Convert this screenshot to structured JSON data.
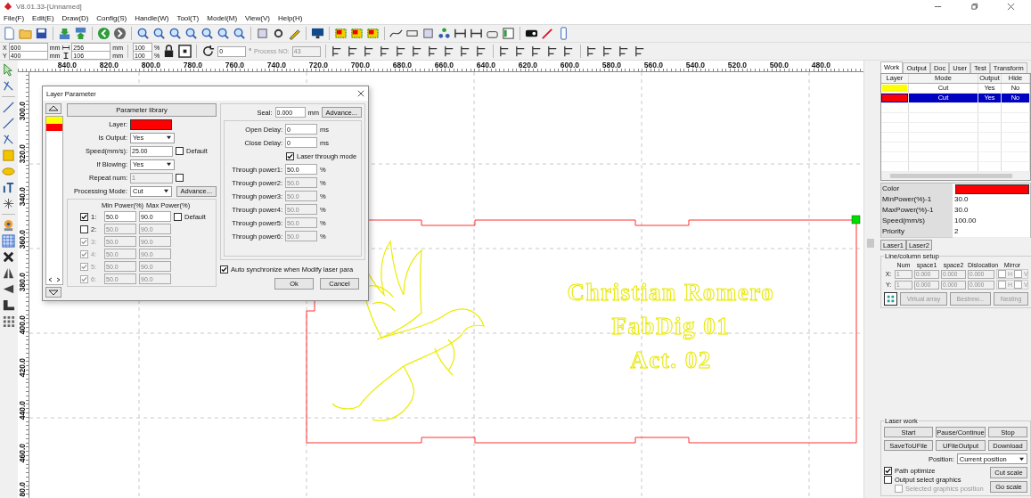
{
  "window": {
    "title": "V8.01.33-[Unnamed]"
  },
  "menu": [
    "File(F)",
    "Edit(E)",
    "Draw(D)",
    "Config(S)",
    "Handle(W)",
    "Tool(T)",
    "Model(M)",
    "View(V)",
    "Help(H)"
  ],
  "size_bar": {
    "x": {
      "label": "X",
      "value": "600",
      "unit": "mm"
    },
    "y": {
      "label": "Y",
      "value": "400",
      "unit": "mm"
    },
    "width": {
      "value": "256",
      "unit": "mm"
    },
    "height": {
      "value": "106",
      "unit": "mm"
    },
    "scale_x": {
      "value": "100",
      "unit": "%"
    },
    "scale_y": {
      "value": "100",
      "unit": "%"
    },
    "rotation": {
      "value": "0",
      "unit": "°"
    },
    "process": {
      "label": "Process NO:",
      "value": "43"
    }
  },
  "ruler": {
    "horizontal": [
      "840.0",
      "820.0",
      "800.0",
      "780.0",
      "760.0",
      "740.0",
      "720.0",
      "700.0",
      "680.0",
      "660.0",
      "640.0",
      "620.0",
      "600.0",
      "580.0",
      "560.0",
      "540.0",
      "520.0",
      "500.0",
      "480.0"
    ],
    "vertical": [
      "300.0",
      "320.0",
      "340.0",
      "360.0",
      "380.0",
      "400.0",
      "420.0",
      "440.0",
      "460.0",
      "80.0"
    ]
  },
  "canvas": {
    "texts": [
      "Christian Romero",
      "FabDig 01",
      "Act. 02"
    ]
  },
  "dialog": {
    "title": "Layer Parameter",
    "layers": [
      {
        "color": "#ffff00"
      },
      {
        "color": "#ff0000"
      }
    ],
    "library_button": "Parameter library",
    "layer": {
      "label": "Layer:",
      "color": "#ff0000"
    },
    "fields": [
      {
        "kind": "select",
        "label": "Is Output:",
        "value": "Yes"
      },
      {
        "kind": "input",
        "label": "Speed(mm/s):",
        "value": "25.00",
        "disabled": false,
        "check": {
          "label": "Default",
          "checked": false
        }
      },
      {
        "kind": "select",
        "label": "If Blowing:",
        "value": "Yes"
      },
      {
        "kind": "input",
        "label": "Repeat num:",
        "value": "1",
        "disabled": true,
        "check": {
          "checked": false
        }
      },
      {
        "kind": "select",
        "label": "Processing Mode:",
        "value": "Cut",
        "button": "Advance..."
      }
    ],
    "power_headers": [
      "Min Power(%)",
      "Max Power(%)"
    ],
    "power_default": {
      "label": "Default",
      "checked": false
    },
    "power_rows": [
      {
        "label": "1:",
        "checked": true,
        "disabled": false,
        "min": "50.0",
        "max": "90.0"
      },
      {
        "label": "2:",
        "checked": false,
        "disabled": false,
        "min": "50.0",
        "max": "90.0"
      },
      {
        "label": "3:",
        "checked": true,
        "disabled": true,
        "min": "50.0",
        "max": "90.0"
      },
      {
        "label": "4:",
        "checked": true,
        "disabled": true,
        "min": "50.0",
        "max": "90.0"
      },
      {
        "label": "5:",
        "checked": true,
        "disabled": true,
        "min": "50.0",
        "max": "90.0"
      },
      {
        "label": "6:",
        "checked": true,
        "disabled": true,
        "min": "50.0",
        "max": "90.0"
      }
    ],
    "seal": {
      "label": "Seal:",
      "value": "0.000",
      "unit": "mm",
      "button": "Advance..."
    },
    "delays": [
      {
        "label": "Open Delay:",
        "value": "0",
        "unit": "ms"
      },
      {
        "label": "Close Delay:",
        "value": "0",
        "unit": "ms"
      }
    ],
    "through_mode": {
      "label": "Laser through mode",
      "checked": true
    },
    "through_powers": [
      {
        "label": "Through power1:",
        "value": "50.0",
        "unit": "%",
        "disabled": false
      },
      {
        "label": "Through power2:",
        "value": "50.0",
        "unit": "%",
        "disabled": true
      },
      {
        "label": "Through power3:",
        "value": "50.0",
        "unit": "%",
        "disabled": true
      },
      {
        "label": "Through power4:",
        "value": "50.0",
        "unit": "%",
        "disabled": true
      },
      {
        "label": "Through power5:",
        "value": "50.0",
        "unit": "%",
        "disabled": true
      },
      {
        "label": "Through power6:",
        "value": "50.0",
        "unit": "%",
        "disabled": true
      }
    ],
    "auto_sync": {
      "label": "Auto synchronize when Modify laser para",
      "checked": true
    },
    "buttons": [
      "Ok",
      "Cancel"
    ]
  },
  "panel": {
    "tabs": [
      {
        "label": "Work",
        "selected": true
      },
      {
        "label": "Output",
        "selected": false
      },
      {
        "label": "Doc",
        "selected": false
      },
      {
        "label": "User",
        "selected": false
      },
      {
        "label": "Test",
        "selected": false
      },
      {
        "label": "Transform",
        "selected": false
      }
    ],
    "columns": [
      "Layer",
      "Mode",
      "Output",
      "Hide"
    ],
    "rows": [
      {
        "color": "#ffff00",
        "mode": "Cut",
        "output": "Yes",
        "hide": "No",
        "selected": false
      },
      {
        "color": "#ff0000",
        "mode": "Cut",
        "output": "Yes",
        "hide": "No",
        "selected": true
      }
    ],
    "properties": [
      {
        "kind": "color",
        "label": "Color",
        "color": "#ff0000"
      },
      {
        "kind": "text",
        "label": "MinPower(%)-1",
        "value": "30.0"
      },
      {
        "kind": "text",
        "label": "MaxPower(%)-1",
        "value": "30.0"
      },
      {
        "kind": "text",
        "label": "Speed(mm/s)",
        "value": "100.00"
      },
      {
        "kind": "text",
        "label": "Priority",
        "value": "2"
      }
    ],
    "laser_tabs": [
      "Laser1",
      "Laser2"
    ],
    "line_column": {
      "title": "Line/column setup",
      "headers": [
        "Num",
        "space1",
        "space2",
        "Dislocation",
        "Mirror"
      ],
      "rows": [
        {
          "label": "X:",
          "num": "1",
          "space1": "0.000",
          "space2": "0.000",
          "dislocation": "0.000",
          "mirror": [
            {
              "label": "H",
              "checked": false
            },
            {
              "label": "V",
              "checked": false
            }
          ]
        },
        {
          "label": "Y:",
          "num": "1",
          "space1": "0.000",
          "space2": "0.000",
          "dislocation": "0.000",
          "mirror": [
            {
              "label": "H",
              "checked": false
            },
            {
              "label": "V",
              "checked": false
            }
          ]
        }
      ],
      "buttons": [
        {
          "label": "Virtual array",
          "disabled": true
        },
        {
          "label": "Bestrew...",
          "disabled": true
        },
        {
          "label": "Nesting",
          "disabled": true
        }
      ]
    },
    "laser_work": {
      "title": "Laser work",
      "buttons": [
        "Start",
        "Pause/Continue",
        "Stop",
        "SaveToUFile",
        "UFileOutput",
        "Download"
      ],
      "position": {
        "label": "Position:",
        "value": "Current position"
      },
      "checks": [
        {
          "label": "Path optimize",
          "checked": true,
          "disabled": false
        },
        {
          "label": "Output select graphics",
          "checked": false,
          "disabled": false
        },
        {
          "label": "Selected graphics position",
          "checked": false,
          "disabled": true
        }
      ],
      "side_buttons": [
        "Cut scale",
        "Go scale"
      ]
    }
  }
}
